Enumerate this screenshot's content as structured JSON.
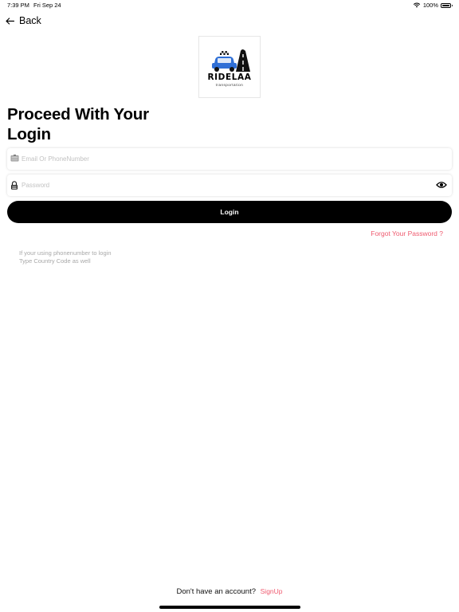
{
  "status_bar": {
    "time": "7:39 PM",
    "date": "Fri Sep 24",
    "battery_text": "100%",
    "battery_level": 1.0
  },
  "nav": {
    "back_label": "Back",
    "back_icon": "arrow-left-icon"
  },
  "logo": {
    "wordmark": "RIDELAA",
    "tagline": "transportation",
    "accent_color": "#2f6fd6"
  },
  "heading": "Proceed With Your Login",
  "form": {
    "email_placeholder": "Email Or PhoneNumber",
    "email_value": "",
    "email_icon": "id-card-icon",
    "password_placeholder": "Password",
    "password_value": "",
    "password_icon": "lock-icon",
    "visibility_icon": "eye-icon",
    "login_label": "Login"
  },
  "forgot_password": "Forgot Your Password ?",
  "hint": {
    "line1": "If your using phonenumber to login",
    "line2": "Type Country Code as well"
  },
  "footer": {
    "question": "Don't have an account?",
    "signup_label": "SignUp"
  },
  "colors": {
    "link": "#ef5a6f",
    "button_bg": "#000000",
    "button_text": "#ffffff",
    "placeholder": "#c2c2c2"
  }
}
